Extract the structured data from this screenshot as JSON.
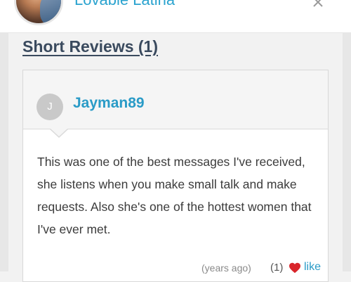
{
  "header": {
    "profile_name": "Lovable Latina",
    "close_icon": "close-icon"
  },
  "section": {
    "title": "Short Reviews (1)"
  },
  "review": {
    "avatar_initial": "J",
    "reviewer_name": "Jayman89",
    "text": "This was one of the best messages I've received, she listens when you make small talk and make requests. Also she's one of the hottest women that I've ever met.",
    "timestamp": "(years ago)",
    "like_count": "(1)",
    "like_label": "like"
  },
  "colors": {
    "accent": "#2a9bc7",
    "heart": "#d9252b",
    "title": "#3a4a5e"
  }
}
